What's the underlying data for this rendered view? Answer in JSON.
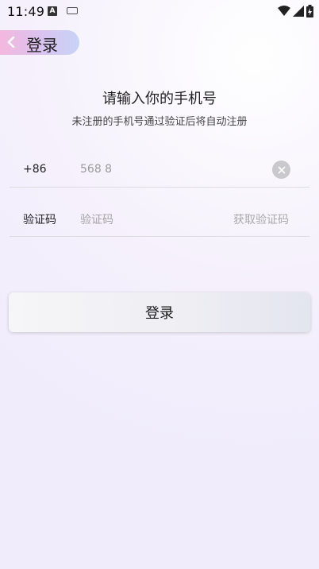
{
  "status_bar": {
    "time": "11:49",
    "notification_icons": [
      "text-a-icon",
      "keyboard-icon"
    ],
    "right_icons": [
      "wifi-icon",
      "cell-signal-icon",
      "battery-charging-icon"
    ]
  },
  "header": {
    "back_label": "登录"
  },
  "main": {
    "title": "请输入你的手机号",
    "subtitle": "未注册的手机号通过验证后将自动注册",
    "phone_row": {
      "country_code": "+86",
      "phone_value": "568 8"
    },
    "code_row": {
      "label": "验证码",
      "placeholder": "验证码",
      "get_code_label": "获取验证码"
    },
    "login_button": "登录"
  },
  "colors": {
    "pill_gradient": [
      "#f4b8de",
      "#c7d4f6"
    ],
    "divider": "#dcdce0"
  }
}
